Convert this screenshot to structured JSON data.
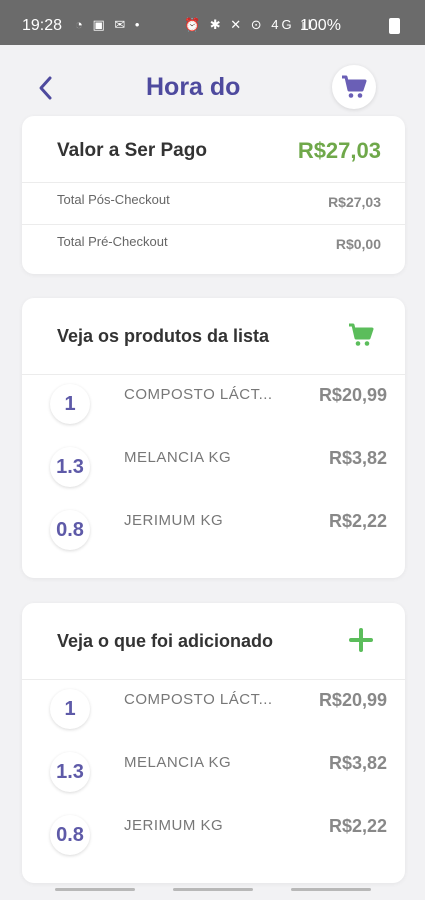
{
  "status_bar": {
    "time": "19:28",
    "left_icons": "◔ ▣ ✉ •",
    "right_icons": "⏰ ✱ ✕ ⊙ 4G ıl",
    "battery": "100%"
  },
  "header": {
    "title": "Hora do",
    "back_icon": "chevron-left-icon",
    "cart_icon": "cart-icon",
    "accent_color": "#4e4a9e"
  },
  "summary": {
    "title": "Valor a Ser Pago",
    "total": "R$27,03",
    "total_color": "#6fa84a",
    "rows": [
      {
        "label": "Total Pós-Checkout",
        "value": "R$27,03"
      },
      {
        "label": "Total Pré-Checkout",
        "value": "R$0,00"
      }
    ]
  },
  "list_section": {
    "title": "Veja os produtos da lista",
    "action_icon": "cart-icon",
    "action_color": "#5bbd5b",
    "items": [
      {
        "qty": "1",
        "name": "COMPOSTO LÁCT...",
        "price": "R$20,99"
      },
      {
        "qty": "1.3",
        "name": "MELANCIA KG",
        "price": "R$3,82"
      },
      {
        "qty": "0.8",
        "name": "JERIMUM KG",
        "price": "R$2,22"
      }
    ]
  },
  "added_section": {
    "title": "Veja o que foi adicionado",
    "action_icon": "plus-icon",
    "action_color": "#5bbd5b",
    "items": [
      {
        "qty": "1",
        "name": "COMPOSTO LÁCT...",
        "price": "R$20,99"
      },
      {
        "qty": "1.3",
        "name": "MELANCIA KG",
        "price": "R$3,82"
      },
      {
        "qty": "0.8",
        "name": "JERIMUM KG",
        "price": "R$2,22"
      }
    ]
  }
}
